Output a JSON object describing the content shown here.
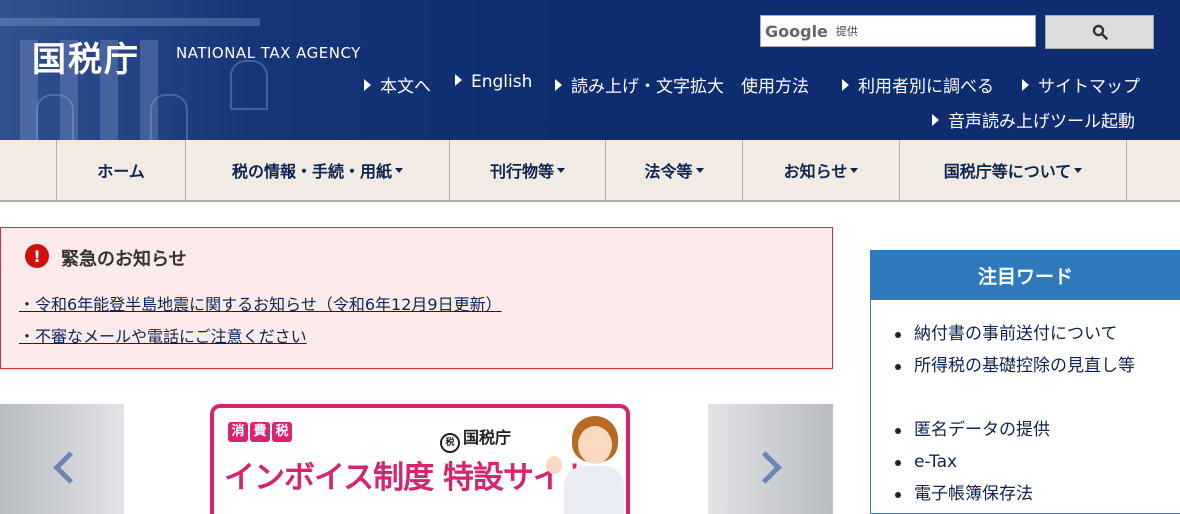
{
  "header": {
    "logo": "国税庁",
    "agency_en": "NATIONAL TAX AGENCY",
    "search": {
      "brand": "Google",
      "provider_label": "提供",
      "value": ""
    },
    "utility_links": [
      {
        "label": "本文へ"
      },
      {
        "label": "English"
      },
      {
        "label": "読み上げ・文字拡大　使用方法"
      },
      {
        "label": "利用者別に調べる"
      },
      {
        "label": "サイトマップ"
      },
      {
        "label": "音声読み上げツール起動"
      }
    ]
  },
  "nav": {
    "items": [
      {
        "label": "ホーム",
        "dropdown": false
      },
      {
        "label": "税の情報・手続・用紙",
        "dropdown": true
      },
      {
        "label": "刊行物等",
        "dropdown": true
      },
      {
        "label": "法令等",
        "dropdown": true
      },
      {
        "label": "お知らせ",
        "dropdown": true
      },
      {
        "label": "国税庁等について",
        "dropdown": true
      }
    ]
  },
  "emergency": {
    "icon": "!",
    "title": "緊急のお知らせ",
    "links": [
      "・令和6年能登半島地震に関するお知らせ（令和6年12月9日更新）",
      "・不審なメールや電話にご注意ください"
    ]
  },
  "banner": {
    "badge": [
      "消",
      "費",
      "税"
    ],
    "nta_mark": "税",
    "nta_label": "国税庁",
    "headline": "インボイス制度 特設サイト"
  },
  "keywords": {
    "title": "注目ワード",
    "items": [
      "納付書の事前送付について",
      "所得税の基礎控除の見直し等",
      "匿名データの提供",
      "e-Tax",
      "電子帳簿保存法"
    ]
  },
  "colors": {
    "header_bg": "#0d2d70",
    "nav_bg": "#f1ebe4",
    "emergency_bg": "#fdeaea",
    "emergency_border": "#c93030",
    "keyword_head": "#2f7abd",
    "banner_accent": "#d6246e"
  }
}
